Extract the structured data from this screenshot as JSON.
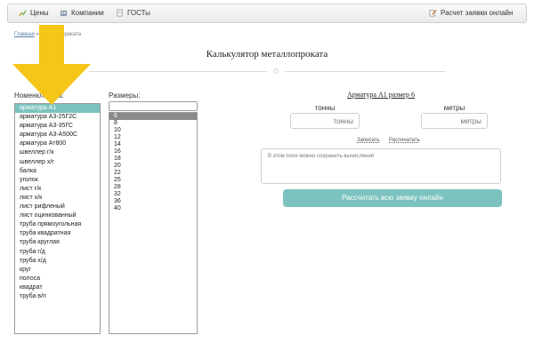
{
  "nav": {
    "prices": "Цены",
    "companies": "Компании",
    "gosts": "ГОСТы",
    "order_online": "Расчет заявки онлайн"
  },
  "breadcrumb": {
    "home": "Главная",
    "separator": " » ",
    "current": "металлопроката"
  },
  "page_title": "Калькулятор металлопроката",
  "nomenclature": {
    "label": "Номенклатура:",
    "items": [
      "арматура А1",
      "арматура А3-25Г2С",
      "арматура А3-35ГС",
      "арматура А3-А500С",
      "арматура Ат800",
      "швеллер г/к",
      "швеллер х/г",
      "балка",
      "уголок",
      "лист г/к",
      "лист х/к",
      "лист рифленый",
      "лист оцинкованный",
      "труба прямоугольная",
      "труба квадратная",
      "труба круглая",
      "труба г/д",
      "труба х/д",
      "круг",
      "полоса",
      "квадрат",
      "труба в/п"
    ],
    "selected_index": 0
  },
  "sizes": {
    "label": "Размеры:",
    "search_value": "",
    "items": [
      "6",
      "8",
      "10",
      "12",
      "14",
      "16",
      "18",
      "20",
      "22",
      "25",
      "28",
      "32",
      "36",
      "40"
    ],
    "selected_index": 0
  },
  "calculator": {
    "title": "Арматура А1 размер 6",
    "tons_label": "тонны",
    "tons_placeholder": "тонны",
    "meters_label": "метры",
    "meters_placeholder": "метры",
    "save_link": "Записать",
    "print_link": "Распечатать",
    "notes_placeholder": "В этом поле можно сохранить вычисления",
    "submit_button": "Рассчитать всю заявку онлайн"
  },
  "colors": {
    "accent": "#7cc3bf",
    "arrow": "#f5c518"
  }
}
